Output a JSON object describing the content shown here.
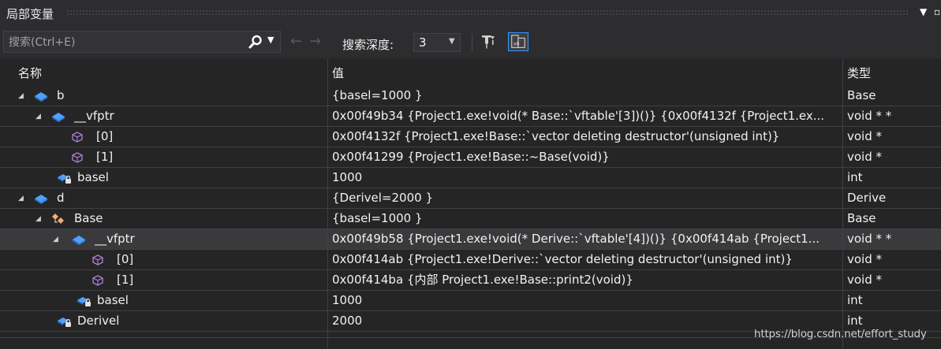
{
  "window": {
    "title": "局部变量"
  },
  "toolbar": {
    "search_placeholder": "搜索(Ctrl+E)",
    "depth_label": "搜索深度:",
    "depth_value": "3"
  },
  "columns": {
    "name": "名称",
    "value": "值",
    "type": "类型"
  },
  "rows": [
    {
      "name": "b",
      "value": "{basel=1000 }",
      "type": "Base",
      "level": 0,
      "expander": "expanded",
      "icon": "object-icon"
    },
    {
      "name": "__vfptr",
      "value": "0x00f49b34 {Project1.exe!void(* Base::`vftable'[3])()} {0x00f4132f {Project1.ex...",
      "type": "void * *",
      "level": 1,
      "expander": "expanded",
      "icon": "object-icon"
    },
    {
      "name": "[0]",
      "value": "0x00f4132f {Project1.exe!Base::`vector deleting destructor'(unsigned int)}",
      "type": "void *",
      "level": 2,
      "expander": "none",
      "icon": "cube-icon"
    },
    {
      "name": "[1]",
      "value": "0x00f41299 {Project1.exe!Base::~Base(void)}",
      "type": "void *",
      "level": 2,
      "expander": "none",
      "icon": "cube-icon"
    },
    {
      "name": "basel",
      "value": "1000",
      "type": "int",
      "level": 1,
      "expander": "none",
      "icon": "protected-field-icon"
    },
    {
      "name": "d",
      "value": "{Derivel=2000 }",
      "type": "Derive",
      "level": 0,
      "expander": "expanded",
      "icon": "object-icon"
    },
    {
      "name": "Base",
      "value": "{basel=1000 }",
      "type": "Base",
      "level": 1,
      "expander": "expanded",
      "icon": "base-class-icon"
    },
    {
      "name": "__vfptr",
      "value": "0x00f49b58 {Project1.exe!void(* Derive::`vftable'[4])()} {0x00f414ab {Project1... ",
      "type": "void * *",
      "level": 2,
      "expander": "expanded",
      "icon": "object-icon",
      "selected": true
    },
    {
      "name": "[0]",
      "value": "0x00f414ab {Project1.exe!Derive::`vector deleting destructor'(unsigned int)}",
      "type": "void *",
      "level": 3,
      "expander": "none",
      "icon": "cube-icon"
    },
    {
      "name": "[1]",
      "value": "0x00f414ba {内部 Project1.exe!Base::print2(void)}",
      "type": "void *",
      "level": 3,
      "expander": "none",
      "icon": "cube-icon"
    },
    {
      "name": "basel",
      "value": "1000",
      "type": "int",
      "level": 2,
      "expander": "none",
      "icon": "protected-field-icon"
    },
    {
      "name": "Derivel",
      "value": "2000",
      "type": "int",
      "level": 1,
      "expander": "none",
      "icon": "protected-field-icon"
    }
  ],
  "watermark": "https://blog.csdn.net/effort_study",
  "colors": {
    "accent": "#3399ff",
    "icon_blue": "#4fa0ff",
    "icon_purple": "#b180d7",
    "base_class_orange": "#f0b070"
  }
}
